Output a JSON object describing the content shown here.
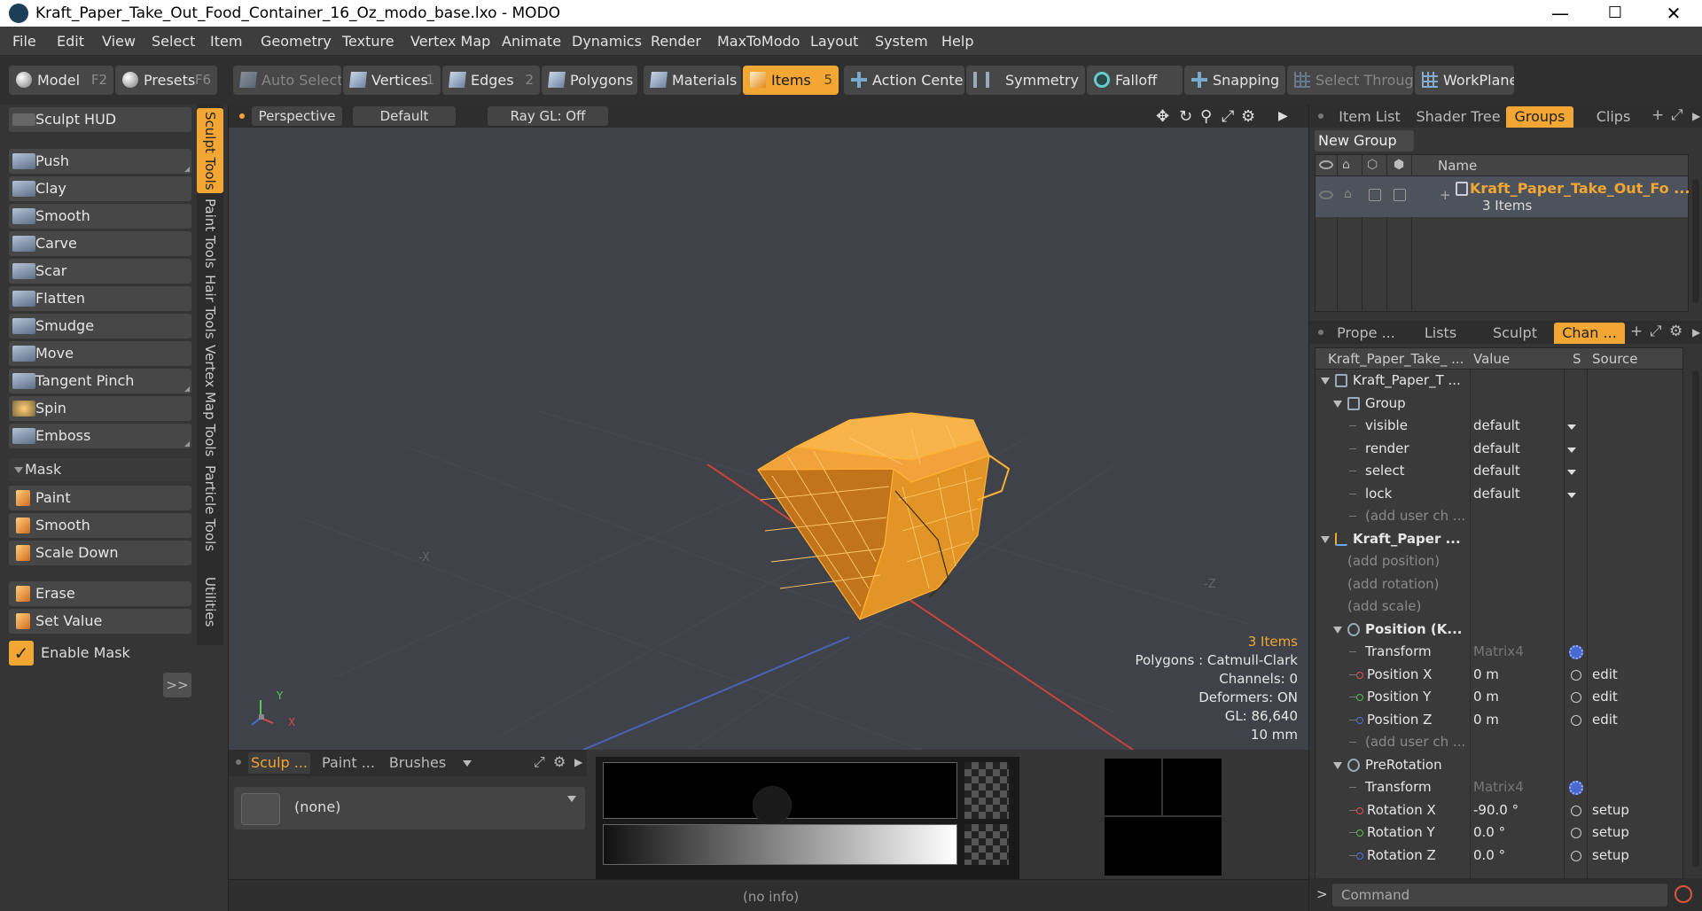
{
  "window": {
    "title": "Kraft_Paper_Take_Out_Food_Container_16_Oz_modo_base.lxo - MODO",
    "minimize": "—",
    "maximize": "☐",
    "close": "✕"
  },
  "menu": [
    "File",
    "Edit",
    "View",
    "Select",
    "Item",
    "Geometry",
    "Texture",
    "Vertex Map",
    "Animate",
    "Dynamics",
    "Render",
    "MaxToModo",
    "Layout",
    "System",
    "Help"
  ],
  "toolbar": {
    "model": "Model",
    "model_key": "F2",
    "presets": "Presets",
    "presets_key": "F6",
    "auto_select": "Auto Select",
    "vertices": "Vertices",
    "vertices_key": "1",
    "edges": "Edges",
    "edges_key": "2",
    "polygons": "Polygons",
    "materials": "Materials",
    "items": "Items",
    "items_key": "5",
    "action_center": "Action Center",
    "symmetry": "Symmetry",
    "falloff": "Falloff",
    "snapping": "Snapping",
    "select_through": "Select Through",
    "workplane": "WorkPlane"
  },
  "left": {
    "sculpt_hud": "Sculpt HUD",
    "tools": [
      "Push",
      "Clay",
      "Smooth",
      "Carve",
      "Scar",
      "Flatten",
      "Smudge",
      "Move",
      "Tangent Pinch",
      "Spin",
      "Emboss"
    ],
    "mask_label": "Mask",
    "mask_tools": [
      "Paint",
      "Smooth",
      "Scale Down"
    ],
    "extra_tools": [
      "Erase",
      "Set Value"
    ],
    "enable_mask": "Enable Mask",
    "expand": ">>",
    "vtabs": [
      "Sculpt Tools",
      "Paint Tools",
      "Hair Tools",
      "Vertex Map Tools",
      "Particle Tools",
      "Utilities"
    ]
  },
  "viewport": {
    "perspective": "Perspective",
    "default": "Default",
    "raygl": "Ray GL: Off",
    "neg_x": "-X",
    "neg_z": "-Z",
    "info": {
      "items": "3 Items",
      "polygons": "Polygons : Catmull-Clark",
      "channels": "Channels: 0",
      "deformers": "Deformers: ON",
      "gl": "GL: 86,640",
      "scale": "10 mm"
    },
    "axis_y": "Y",
    "axis_x": "X",
    "icons": [
      "move-icon",
      "rotate-icon",
      "zoom-icon",
      "maximize-icon",
      "gear-icon",
      "play-icon"
    ]
  },
  "bottom": {
    "tabs": [
      "Sculp ...",
      "Paint ...",
      "Brushes"
    ],
    "none_label": "(none)",
    "status": "(no info)"
  },
  "right": {
    "top_tabs": [
      "Item List",
      "Shader Tree",
      "Groups",
      "Clips"
    ],
    "new_group": "New Group",
    "name_col": "Name",
    "group_name": "Kraft_Paper_Take_Out_Fo ...",
    "group_count": "3 Items",
    "plus": "+",
    "chan_tabs": [
      "Prope ...",
      "Lists",
      "Sculpt",
      "Chan ..."
    ],
    "chan_header": {
      "name": "Kraft_Paper_Take_ ...",
      "value": "Value",
      "s": "S",
      "source": "Source"
    },
    "rows": [
      {
        "name": "Kraft_Paper_T ...",
        "indent": 1,
        "kind": "mesh",
        "tri": true
      },
      {
        "name": "Group",
        "indent": 2,
        "kind": "mesh",
        "tri": true
      },
      {
        "name": "visible",
        "indent": 3,
        "value": "default",
        "dd": true
      },
      {
        "name": "render",
        "indent": 3,
        "value": "default",
        "dd": true
      },
      {
        "name": "select",
        "indent": 3,
        "value": "default",
        "dd": true
      },
      {
        "name": "lock",
        "indent": 3,
        "value": "default",
        "dd": true
      },
      {
        "name": "(add user ch ...",
        "indent": 3,
        "gray": true
      },
      {
        "name": "Kraft_Paper ...",
        "indent": 1,
        "kind": "locator",
        "tri": true,
        "bold": true
      },
      {
        "name": "(add position)",
        "indent": 2,
        "gray": true
      },
      {
        "name": "(add rotation)",
        "indent": 2,
        "gray": true
      },
      {
        "name": "(add scale)",
        "indent": 2,
        "gray": true
      },
      {
        "name": "Position (K...",
        "indent": 2,
        "kind": "pos",
        "tri": true,
        "bold": true
      },
      {
        "name": "Transform",
        "indent": 3,
        "value": "Matrix4",
        "vgray": true,
        "gear": true
      },
      {
        "name": "Position X",
        "indent": 3,
        "dot": "#e05050",
        "value": "0 m",
        "s": true,
        "source": "edit"
      },
      {
        "name": "Position Y",
        "indent": 3,
        "dot": "#50c050",
        "value": "0 m",
        "s": true,
        "source": "edit"
      },
      {
        "name": "Position Z",
        "indent": 3,
        "dot": "#5070e0",
        "value": "0 m",
        "s": true,
        "source": "edit"
      },
      {
        "name": "(add user ch ...",
        "indent": 3,
        "gray": true
      },
      {
        "name": "PreRotation",
        "indent": 2,
        "kind": "rot",
        "tri": true
      },
      {
        "name": "Transform",
        "indent": 3,
        "value": "Matrix4",
        "vgray": true,
        "gear": true
      },
      {
        "name": "Rotation X",
        "indent": 3,
        "dot": "#e05050",
        "value": "-90.0 °",
        "s": true,
        "source": "setup"
      },
      {
        "name": "Rotation Y",
        "indent": 3,
        "dot": "#50c050",
        "value": "0.0 °",
        "s": true,
        "source": "setup"
      },
      {
        "name": "Rotation Z",
        "indent": 3,
        "dot": "#5070e0",
        "value": "0.0 °",
        "s": true,
        "source": "setup"
      }
    ],
    "command_prompt": ">",
    "command_placeholder": "Command"
  },
  "colors": {
    "accent": "#f2a634",
    "viewport_bg": "#3f4248",
    "mesh": "#f5a623"
  }
}
